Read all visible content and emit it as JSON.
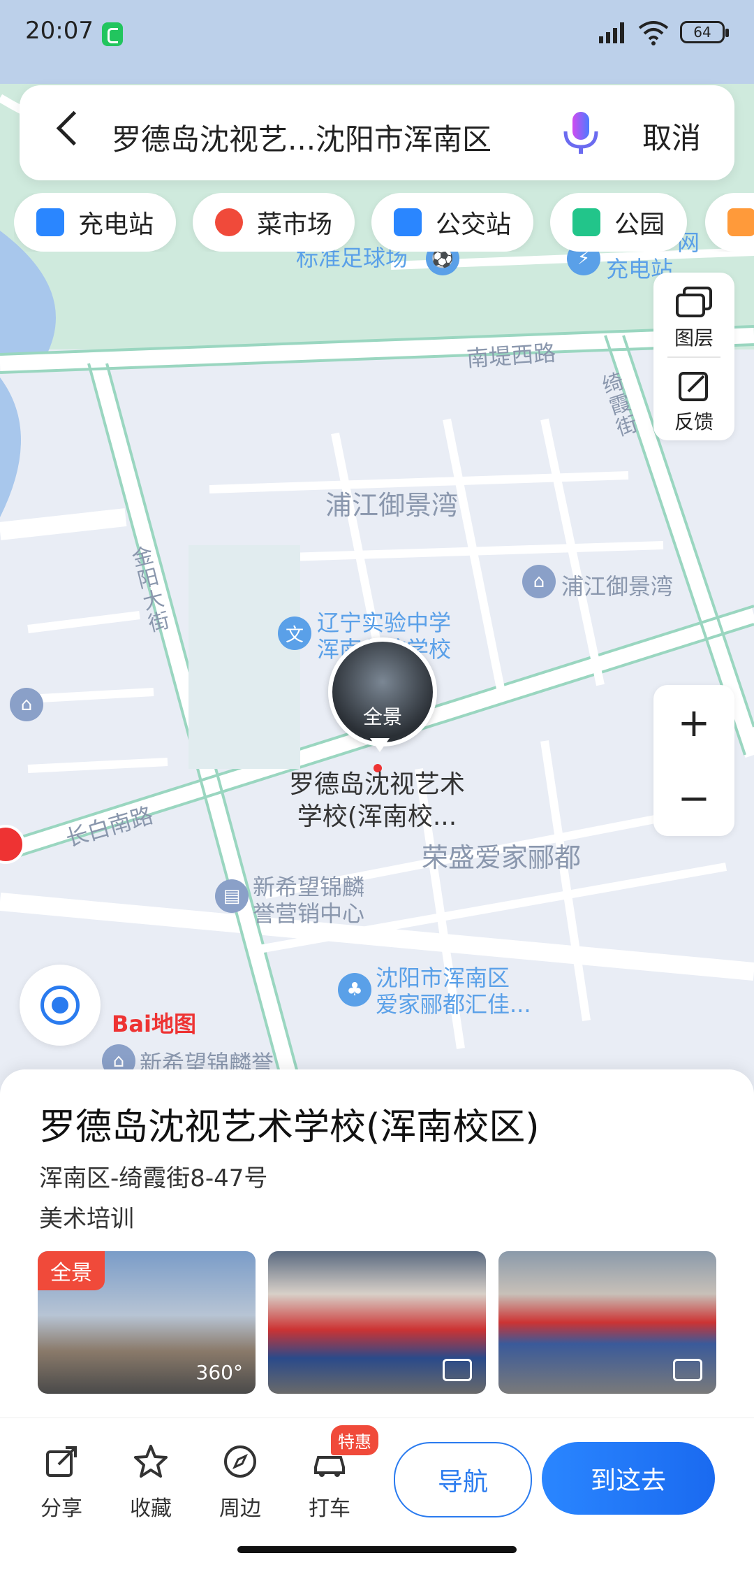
{
  "status_bar": {
    "time": "20:07",
    "battery": "64"
  },
  "search": {
    "query": "罗德岛沈视艺...沈阳市浑南区",
    "cancel_label": "取消"
  },
  "chips": [
    {
      "label": "充电站",
      "color": "#2a86ff"
    },
    {
      "label": "菜市场",
      "color": "#f04a3a"
    },
    {
      "label": "公交站",
      "color": "#2a86ff"
    },
    {
      "label": "公园",
      "color": "#22c58a"
    }
  ],
  "map_controls": {
    "layers_label": "图层",
    "feedback_label": "反馈",
    "zoom_in": "+",
    "zoom_out": "−"
  },
  "map_labels": {
    "stadium": "标准足球场",
    "charge": "充电站",
    "net": "网",
    "road_nandi": "南堤西路",
    "road_qixia": "绮霞街",
    "pujiang_area": "浦江御景湾",
    "pujiang_poi": "浦江御景湾",
    "school1": "辽宁实验中学",
    "school2": "浑南分校学校",
    "road_jinyang": "金阳大街",
    "road_changbai": "长白南路",
    "rongsheng": "荣盛爱家郦都",
    "xinxiwang1": "新希望锦麟",
    "xinxiwang2": "誉营销中心",
    "hunnan1": "沈阳市浑南区",
    "hunnan2": "爱家郦都汇佳...",
    "xinxiwang_bottom": "新希望锦麟誉",
    "baidu": "Bai地图"
  },
  "marker": {
    "pano_label": "全景",
    "name": "罗德岛沈视艺术学校(浑南校..."
  },
  "place": {
    "title": "罗德岛沈视艺术学校(浑南校区)",
    "address": "浑南区-绮霞街8-47号",
    "category": "美术培训",
    "photo1_tag": "全景",
    "photo1_360": "360°"
  },
  "actions": {
    "share": "分享",
    "favorite": "收藏",
    "nearby": "周边",
    "taxi": "打车",
    "deal_badge": "特惠",
    "navigate": "导航",
    "go_here": "到这去"
  }
}
